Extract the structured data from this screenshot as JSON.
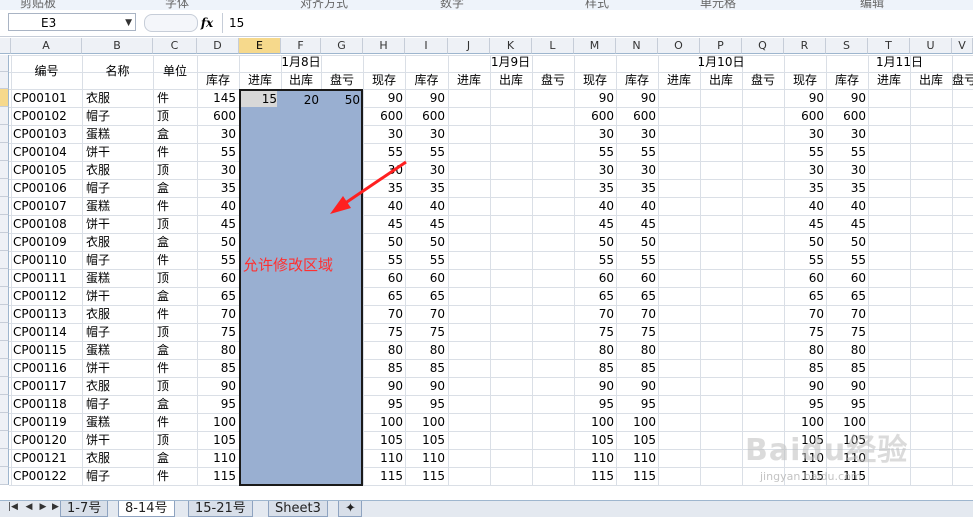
{
  "ribbon_partial": [
    "剪贴板",
    "字体",
    "对齐方式",
    "数字",
    "样式",
    "单元格",
    "编辑"
  ],
  "formula_bar": {
    "name_box": "E3",
    "fx": "fx",
    "value": "15"
  },
  "column_letters": [
    "A",
    "B",
    "C",
    "D",
    "E",
    "F",
    "G",
    "H",
    "I",
    "J",
    "K",
    "L",
    "M",
    "N",
    "O",
    "P",
    "Q",
    "R",
    "S",
    "T",
    "U",
    "V"
  ],
  "header": {
    "code": "编号",
    "name": "名称",
    "unit": "单位",
    "dates": [
      "1月8日",
      "1月9日",
      "1月10日",
      "1月11日"
    ],
    "sub": [
      "库存",
      "进库",
      "出库",
      "盘亏",
      "现存",
      "库存",
      "进库",
      "出库",
      "盘亏",
      "现存",
      "库存",
      "进库",
      "出库",
      "盘亏",
      "现存",
      "库存",
      "进库",
      "出库",
      "盘亏"
    ]
  },
  "rows": [
    {
      "code": "CP00101",
      "name": "衣服",
      "unit": "件",
      "stock": "145",
      "in": "15",
      "out": "20",
      "loss": "50",
      "now": "90",
      "s2": "90",
      "n2": "90",
      "s3": "90",
      "n3": "90",
      "s4": "90"
    },
    {
      "code": "CP00102",
      "name": "帽子",
      "unit": "顶",
      "stock": "600",
      "now": "600",
      "s2": "600",
      "n2": "600",
      "s3": "600",
      "n3": "600",
      "s4": "600"
    },
    {
      "code": "CP00103",
      "name": "蛋糕",
      "unit": "盒",
      "stock": "30",
      "now": "30",
      "s2": "30",
      "n2": "30",
      "s3": "30",
      "n3": "30",
      "s4": "30"
    },
    {
      "code": "CP00104",
      "name": "饼干",
      "unit": "件",
      "stock": "55",
      "now": "55",
      "s2": "55",
      "n2": "55",
      "s3": "55",
      "n3": "55",
      "s4": "55"
    },
    {
      "code": "CP00105",
      "name": "衣服",
      "unit": "顶",
      "stock": "30",
      "now": "30",
      "s2": "30",
      "n2": "30",
      "s3": "30",
      "n3": "30",
      "s4": "30"
    },
    {
      "code": "CP00106",
      "name": "帽子",
      "unit": "盒",
      "stock": "35",
      "now": "35",
      "s2": "35",
      "n2": "35",
      "s3": "35",
      "n3": "35",
      "s4": "35"
    },
    {
      "code": "CP00107",
      "name": "蛋糕",
      "unit": "件",
      "stock": "40",
      "now": "40",
      "s2": "40",
      "n2": "40",
      "s3": "40",
      "n3": "40",
      "s4": "40"
    },
    {
      "code": "CP00108",
      "name": "饼干",
      "unit": "顶",
      "stock": "45",
      "now": "45",
      "s2": "45",
      "n2": "45",
      "s3": "45",
      "n3": "45",
      "s4": "45"
    },
    {
      "code": "CP00109",
      "name": "衣服",
      "unit": "盒",
      "stock": "50",
      "now": "50",
      "s2": "50",
      "n2": "50",
      "s3": "50",
      "n3": "50",
      "s4": "50"
    },
    {
      "code": "CP00110",
      "name": "帽子",
      "unit": "件",
      "stock": "55",
      "now": "55",
      "s2": "55",
      "n2": "55",
      "s3": "55",
      "n3": "55",
      "s4": "55"
    },
    {
      "code": "CP00111",
      "name": "蛋糕",
      "unit": "顶",
      "stock": "60",
      "now": "60",
      "s2": "60",
      "n2": "60",
      "s3": "60",
      "n3": "60",
      "s4": "60"
    },
    {
      "code": "CP00112",
      "name": "饼干",
      "unit": "盒",
      "stock": "65",
      "now": "65",
      "s2": "65",
      "n2": "65",
      "s3": "65",
      "n3": "65",
      "s4": "65"
    },
    {
      "code": "CP00113",
      "name": "衣服",
      "unit": "件",
      "stock": "70",
      "now": "70",
      "s2": "70",
      "n2": "70",
      "s3": "70",
      "n3": "70",
      "s4": "70"
    },
    {
      "code": "CP00114",
      "name": "帽子",
      "unit": "顶",
      "stock": "75",
      "now": "75",
      "s2": "75",
      "n2": "75",
      "s3": "75",
      "n3": "75",
      "s4": "75"
    },
    {
      "code": "CP00115",
      "name": "蛋糕",
      "unit": "盒",
      "stock": "80",
      "now": "80",
      "s2": "80",
      "n2": "80",
      "s3": "80",
      "n3": "80",
      "s4": "80"
    },
    {
      "code": "CP00116",
      "name": "饼干",
      "unit": "件",
      "stock": "85",
      "now": "85",
      "s2": "85",
      "n2": "85",
      "s3": "85",
      "n3": "85",
      "s4": "85"
    },
    {
      "code": "CP00117",
      "name": "衣服",
      "unit": "顶",
      "stock": "90",
      "now": "90",
      "s2": "90",
      "n2": "90",
      "s3": "90",
      "n3": "90",
      "s4": "90"
    },
    {
      "code": "CP00118",
      "name": "帽子",
      "unit": "盒",
      "stock": "95",
      "now": "95",
      "s2": "95",
      "n2": "95",
      "s3": "95",
      "n3": "95",
      "s4": "95"
    },
    {
      "code": "CP00119",
      "name": "蛋糕",
      "unit": "件",
      "stock": "100",
      "now": "100",
      "s2": "100",
      "n2": "100",
      "s3": "100",
      "n3": "100",
      "s4": "100"
    },
    {
      "code": "CP00120",
      "name": "饼干",
      "unit": "顶",
      "stock": "105",
      "now": "105",
      "s2": "105",
      "n2": "105",
      "s3": "105",
      "n3": "105",
      "s4": "105"
    },
    {
      "code": "CP00121",
      "name": "衣服",
      "unit": "盒",
      "stock": "110",
      "now": "110",
      "s2": "110",
      "n2": "110",
      "s3": "110",
      "n3": "110",
      "s4": "110"
    },
    {
      "code": "CP00122",
      "name": "帽子",
      "unit": "件",
      "stock": "115",
      "now": "115",
      "s2": "115",
      "n2": "115",
      "s3": "115",
      "n3": "115",
      "s4": "115"
    }
  ],
  "annotation": "允许修改区域",
  "sheet_tabs": [
    "1-7号",
    "8-14号",
    "15-21号",
    "Sheet3"
  ],
  "active_tab": "8-14号",
  "colors": {
    "zone_fill": "#99afd1",
    "annotation": "#ff3030",
    "selected_header": "#f6d98c"
  },
  "watermark": {
    "brand": "Baidu经验",
    "url": "jingyan.baidu.com"
  }
}
